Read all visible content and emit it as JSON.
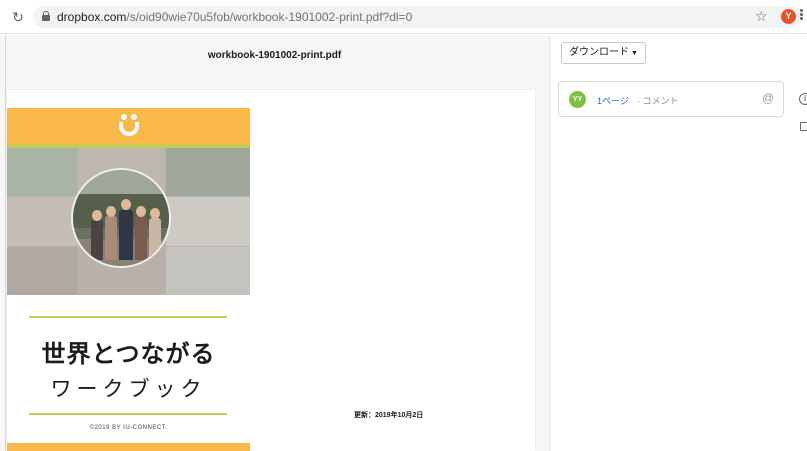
{
  "browser": {
    "url_host": "dropbox.com",
    "url_path": "/s/oid90wie70u5fob/workbook-1901002-print.pdf?dl=0",
    "profile_initial": "Y"
  },
  "preview": {
    "file_name": "workbook-1901002-print.pdf",
    "cover_title": "世界とつながる",
    "cover_subtitle": "ワークブック",
    "copyright": "©2019 BY IU-CONNECT.",
    "updated": "更新：2019年10月2日"
  },
  "sidebar": {
    "download_label": "ダウンロード",
    "comment": {
      "avatar_initials": "YY",
      "page_ref": "1ページ",
      "hint": "· コメント"
    }
  },
  "colors": {
    "brand_orange": "#f8b94a",
    "brand_green": "#b5d25c",
    "link_blue": "#2e6bd4",
    "avatar_green": "#7cc142"
  }
}
